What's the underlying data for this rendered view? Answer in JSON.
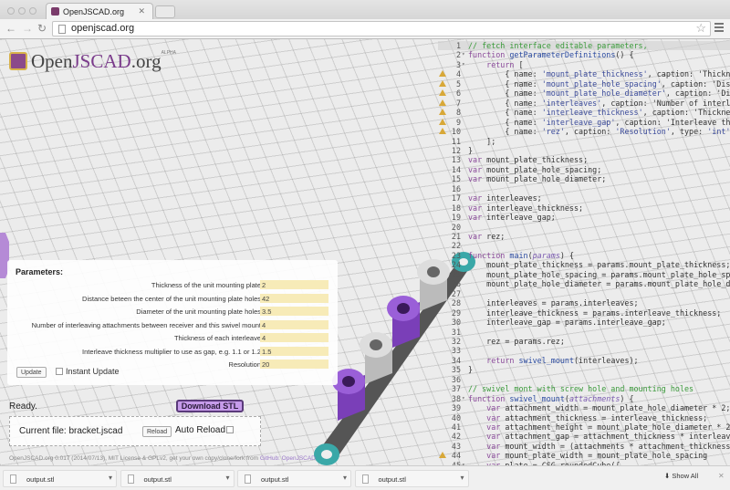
{
  "browser": {
    "tab_title": "OpenJSCAD.org",
    "url": "openjscad.org"
  },
  "logo": {
    "text_open": "Open",
    "text_jscad": "JSCAD",
    "text_org": ".org",
    "badge": "ALPHA"
  },
  "parameters": {
    "title": "Parameters:",
    "rows": [
      {
        "label": "Thickness of the unit mounting plate",
        "value": "2"
      },
      {
        "label": "Distance beteen the center of the unit mounting plate holes",
        "value": "42"
      },
      {
        "label": "Diameter of the unit mounting plate holes",
        "value": "3.5"
      },
      {
        "label": "Number of interleaving attachments between receiver and this swivel mount",
        "value": "4"
      },
      {
        "label": "Thickness of each interleave",
        "value": "4"
      },
      {
        "label": "Interleave thickness multiplier to use as gap, e.g. 1.1 or 1.2",
        "value": "1.5"
      },
      {
        "label": "Resolution",
        "value": "20"
      }
    ],
    "update_label": "Update",
    "instant_update_label": "Instant Update"
  },
  "status": {
    "text": "Ready.",
    "download_label": "Download STL"
  },
  "file": {
    "current": "Current file: bracket.jscad",
    "reload_label": "Reload",
    "auto_reload_label": "Auto Reload"
  },
  "footer": {
    "text": "OpenJSCAD.org 0.017 (2014/07/13), MIT License & GPLv2, get your own copy/clone/fork from ",
    "link": "GitHub: OpenJSCAD"
  },
  "editor": {
    "lines": [
      {
        "n": "1",
        "t": "// fetch interface editable parameters,"
      },
      {
        "n": "2",
        "t": "function getParameterDefinitions() {",
        "fold": true
      },
      {
        "n": "3",
        "t": "    return [",
        "fold": true
      },
      {
        "n": "4",
        "t": "        { name: 'mount_plate_thickness', caption: 'Thickness",
        "warn": true
      },
      {
        "n": "5",
        "t": "        { name: 'mount_plate_hole_spacing', caption: 'Dista",
        "warn": true
      },
      {
        "n": "6",
        "t": "        { name: 'mount_plate_hole_diameter', caption: 'Diam",
        "warn": true
      },
      {
        "n": "7",
        "t": "        { name: 'interleaves', caption: 'Number of interlea",
        "warn": true
      },
      {
        "n": "8",
        "t": "        { name: 'interleave_thickness', caption: 'Thickness",
        "warn": true
      },
      {
        "n": "9",
        "t": "        { name: 'interleave_gap', caption: 'Interleave thic",
        "warn": true
      },
      {
        "n": "10",
        "t": "        { name: 'rez', caption: 'Resolution', type: 'int',",
        "warn": true
      },
      {
        "n": "11",
        "t": "    ];"
      },
      {
        "n": "12",
        "t": "}"
      },
      {
        "n": "13",
        "t": "var mount_plate_thickness;"
      },
      {
        "n": "14",
        "t": "var mount_plate_hole_spacing;"
      },
      {
        "n": "15",
        "t": "var mount_plate_hole_diameter;"
      },
      {
        "n": "16",
        "t": ""
      },
      {
        "n": "17",
        "t": "var interleaves;"
      },
      {
        "n": "18",
        "t": "var interleave_thickness;"
      },
      {
        "n": "19",
        "t": "var interleave_gap;"
      },
      {
        "n": "20",
        "t": ""
      },
      {
        "n": "21",
        "t": "var rez;"
      },
      {
        "n": "22",
        "t": ""
      },
      {
        "n": "23",
        "t": "function main(params) {"
      },
      {
        "n": "24",
        "t": "    mount_plate_thickness = params.mount_plate_thickness;"
      },
      {
        "n": "25",
        "t": "    mount_plate_hole_spacing = params.mount_plate_hole_spacing;"
      },
      {
        "n": "26",
        "t": "    mount_plate_hole_diameter = params.mount_plate_hole_diameter;"
      },
      {
        "n": "27",
        "t": ""
      },
      {
        "n": "28",
        "t": "    interleaves = params.interleaves;"
      },
      {
        "n": "29",
        "t": "    interleave_thickness = params.interleave_thickness;"
      },
      {
        "n": "30",
        "t": "    interleave_gap = params.interleave_gap;"
      },
      {
        "n": "31",
        "t": ""
      },
      {
        "n": "32",
        "t": "    rez = params.rez;"
      },
      {
        "n": "33",
        "t": ""
      },
      {
        "n": "34",
        "t": "    return swivel_mount(interleaves);"
      },
      {
        "n": "35",
        "t": "}"
      },
      {
        "n": "36",
        "t": ""
      },
      {
        "n": "37",
        "t": "// swivel mont with screw hole and mounting holes"
      },
      {
        "n": "38",
        "t": "function swivel_mount(attachments) {",
        "fold": true
      },
      {
        "n": "39",
        "t": "    var attachment_width = mount_plate_hole_diameter * 2;"
      },
      {
        "n": "40",
        "t": "    var attachment_thickness = interleave_thickness;"
      },
      {
        "n": "41",
        "t": "    var attachment_height = mount_plate_hole_diameter * 2;"
      },
      {
        "n": "42",
        "t": "    var attachment_gap = attachment_thickness * interleave_"
      },
      {
        "n": "43",
        "t": "    var mount_width = (attachments * attachment_thickness)"
      },
      {
        "n": "44",
        "t": "    var mount_plate_width = mount_plate_hole_spacing",
        "warn": true
      },
      {
        "n": "45",
        "t": "    var plate = CSG.roundedCube({",
        "fold": true
      }
    ]
  },
  "downloads": {
    "items": [
      "output.stl",
      "output.stl",
      "output.stl",
      "output.stl"
    ],
    "show_all_label": "Show All"
  }
}
